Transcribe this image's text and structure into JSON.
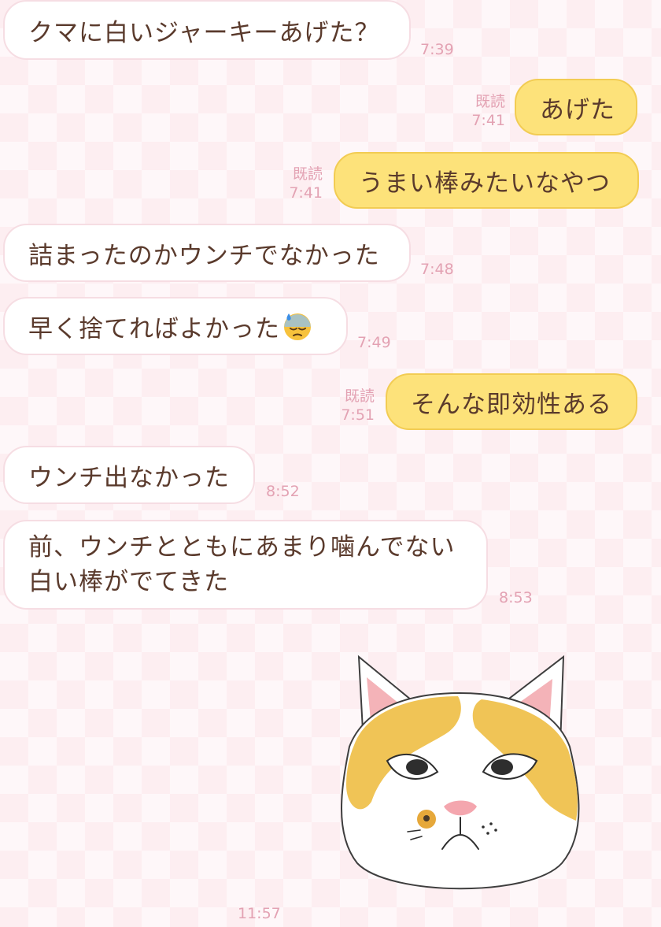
{
  "messages": [
    {
      "side": "in",
      "text": "クマに白いジャーキーあげた？",
      "time": "7:39"
    },
    {
      "side": "out",
      "text": "あげた",
      "read": "既読",
      "time": "7:41"
    },
    {
      "side": "out",
      "text": "うまい棒みたいなやつ",
      "read": "既読",
      "time": "7:41"
    },
    {
      "side": "in",
      "text": "詰まったのかウンチでなかった",
      "time": "7:48"
    },
    {
      "side": "in",
      "text": "早く捨てればよかった",
      "emoji": "downcast-face-with-sweat-emoji",
      "time": "7:49"
    },
    {
      "side": "out",
      "text": "そんな即効性ある",
      "read": "既読",
      "time": "7:51"
    },
    {
      "side": "in",
      "text": "ウンチ出なかった",
      "time": "8:52"
    },
    {
      "side": "in",
      "lines": [
        "前、ウンチとともにあまり噛んでない",
        "白い棒がでてきた"
      ],
      "time": "8:53"
    },
    {
      "side": "in",
      "sticker": "cat-face-sticker",
      "time": "11:57"
    }
  ],
  "colors": {
    "background": "#fdeef1",
    "incoming_bubble": "#ffffff",
    "outgoing_bubble": "#fde27a",
    "text": "#5a3a2c",
    "meta": "#e3a2b3"
  }
}
